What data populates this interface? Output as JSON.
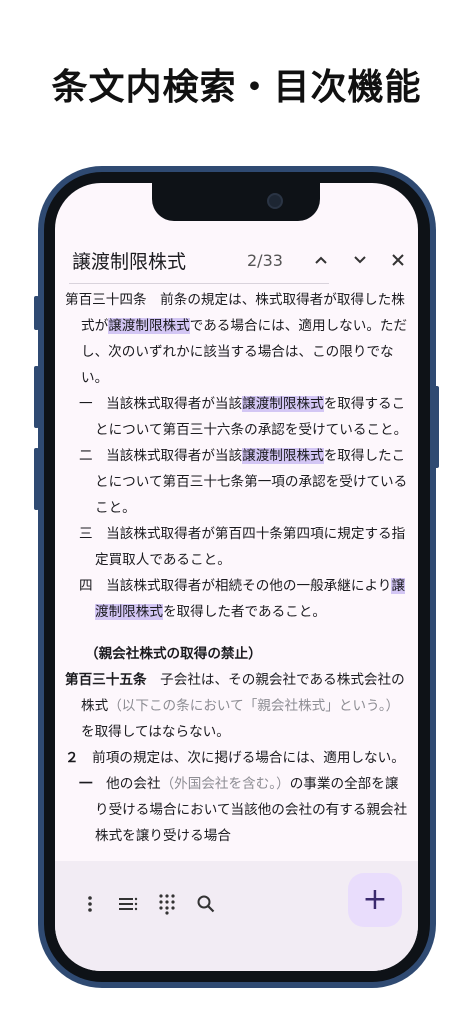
{
  "headline": "条文内検索・目次機能",
  "search": {
    "term": "譲渡制限株式",
    "counter": "2/33"
  },
  "icons": {
    "prev": "chevron-up-icon",
    "next": "chevron-down-icon",
    "close": "close-icon",
    "menu": "more-vertical-icon",
    "toc": "list-icon",
    "grid": "grid-icon",
    "search": "search-icon",
    "add": "plus-icon"
  },
  "article134": {
    "head": "第百三十四条",
    "t1": "　前条の規定は、株式取得者が取得した株式が",
    "hl": "譲渡制限株式",
    "t2": "である場合には、適用しない。ただし、次のいずれかに該当する場合は、この限りでない。",
    "items": [
      {
        "num": "一",
        "t1": "　当該株式取得者が当該",
        "hl": "譲渡制限株式",
        "t2": "を取得することについて第百三十六条の承認を受けていること。"
      },
      {
        "num": "二",
        "t1": "　当該株式取得者が当該",
        "hl": "譲渡制限株式",
        "t2": "を取得したことについて第百三十七条第一項の承認を受けていること。"
      },
      {
        "num": "三",
        "t1": "　当該株式取得者が第百四十条第四項に規定する指定買取人であること。",
        "hl": "",
        "t2": ""
      },
      {
        "num": "四",
        "t1": "　当該株式取得者が相続その他の一般承継により",
        "hl": "譲渡制限株式",
        "t2": "を取得した者であること。"
      }
    ]
  },
  "caption135": "（親会社株式の取得の禁止）",
  "article135": {
    "head": "第百三十五条",
    "t1": "　子会社は、その親会社である株式会社の株式",
    "muted": "（以下この条において「親会社株式」という。）",
    "t2": "を取得してはならない。",
    "para2_num": "２",
    "para2_text": "　前項の規定は、次に掲げる場合には、適用しない。",
    "item1_num": "一",
    "item1_t1": "　他の会社",
    "item1_muted": "（外国会社を含む。）",
    "item1_t2": "の事業の全部を譲り受ける場合において当該他の会社の有する親会社株式を譲り受ける場合"
  }
}
